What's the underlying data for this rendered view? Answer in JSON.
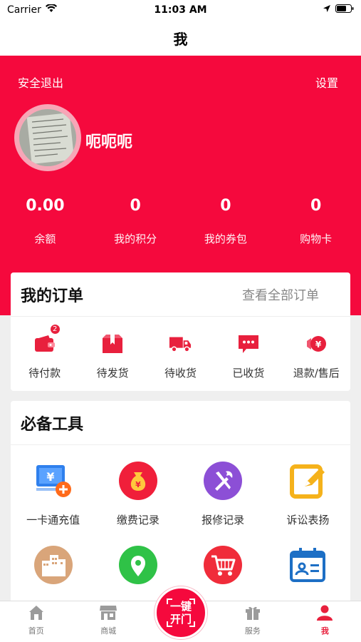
{
  "status_bar": {
    "carrier": "Carrier",
    "time": "11:03 AM"
  },
  "nav": {
    "title": "我"
  },
  "profile": {
    "logout_label": "安全退出",
    "settings_label": "设置",
    "username": "呃呃呃",
    "stats": [
      {
        "value": "0.00",
        "label": "余额"
      },
      {
        "value": "0",
        "label": "我的积分"
      },
      {
        "value": "0",
        "label": "我的券包"
      },
      {
        "value": "0",
        "label": "购物卡"
      }
    ]
  },
  "orders": {
    "title": "我的订单",
    "view_all": "查看全部订单",
    "items": [
      {
        "label": "待付款",
        "badge": "2",
        "icon": "wallet-icon"
      },
      {
        "label": "待发货",
        "icon": "package-icon"
      },
      {
        "label": "待收货",
        "icon": "truck-icon"
      },
      {
        "label": "已收货",
        "icon": "message-box-icon"
      },
      {
        "label": "退款/售后",
        "icon": "refund-coin-icon"
      }
    ]
  },
  "tools": {
    "title": "必备工具",
    "items": [
      {
        "label": "一卡通充值",
        "icon": "card-recharge-icon"
      },
      {
        "label": "缴费记录",
        "icon": "money-bag-icon"
      },
      {
        "label": "报修记录",
        "icon": "repair-tools-icon"
      },
      {
        "label": "诉讼表扬",
        "icon": "edit-note-icon"
      },
      {
        "label": "",
        "icon": "buildings-icon"
      },
      {
        "label": "",
        "icon": "location-pin-icon"
      },
      {
        "label": "",
        "icon": "shopping-cart-icon"
      },
      {
        "label": "",
        "icon": "contact-calendar-icon"
      }
    ]
  },
  "tabbar": {
    "items": [
      {
        "label": "首页",
        "icon": "home-icon"
      },
      {
        "label": "商城",
        "icon": "store-icon"
      },
      {
        "label": "服务",
        "icon": "gift-icon"
      },
      {
        "label": "我",
        "icon": "person-icon"
      }
    ],
    "center_line1": "一键",
    "center_line2": "开门"
  },
  "colors": {
    "accent": "#f5093d",
    "page_bg": "#efefef"
  }
}
